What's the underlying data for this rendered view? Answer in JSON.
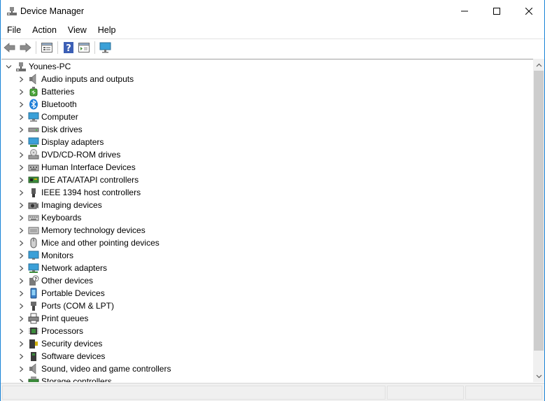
{
  "window": {
    "title": "Device Manager",
    "accent": "#1883d7"
  },
  "menu": {
    "items": [
      "File",
      "Action",
      "View",
      "Help"
    ]
  },
  "toolbar": {
    "buttons": [
      "back-icon",
      "forward-icon",
      "properties-icon",
      "help-icon",
      "show-hide-icon",
      "monitor-icon"
    ]
  },
  "tree": {
    "root": "Younes-PC",
    "categories": [
      {
        "label": "Audio inputs and outputs",
        "icon": "speaker-icon"
      },
      {
        "label": "Batteries",
        "icon": "battery-icon"
      },
      {
        "label": "Bluetooth",
        "icon": "bluetooth-icon"
      },
      {
        "label": "Computer",
        "icon": "computer-icon"
      },
      {
        "label": "Disk drives",
        "icon": "disk-drive-icon"
      },
      {
        "label": "Display adapters",
        "icon": "display-adapter-icon"
      },
      {
        "label": "DVD/CD-ROM drives",
        "icon": "dvd-drive-icon"
      },
      {
        "label": "Human Interface Devices",
        "icon": "hid-icon"
      },
      {
        "label": "IDE ATA/ATAPI controllers",
        "icon": "ide-controller-icon"
      },
      {
        "label": "IEEE 1394 host controllers",
        "icon": "ieee1394-icon"
      },
      {
        "label": "Imaging devices",
        "icon": "camera-icon"
      },
      {
        "label": "Keyboards",
        "icon": "keyboard-icon"
      },
      {
        "label": "Memory technology devices",
        "icon": "memory-icon"
      },
      {
        "label": "Mice and other pointing devices",
        "icon": "mouse-icon"
      },
      {
        "label": "Monitors",
        "icon": "monitor-icon"
      },
      {
        "label": "Network adapters",
        "icon": "network-adapter-icon"
      },
      {
        "label": "Other devices",
        "icon": "unknown-device-icon"
      },
      {
        "label": "Portable Devices",
        "icon": "portable-device-icon"
      },
      {
        "label": "Ports (COM & LPT)",
        "icon": "port-icon"
      },
      {
        "label": "Print queues",
        "icon": "printer-icon"
      },
      {
        "label": "Processors",
        "icon": "processor-icon"
      },
      {
        "label": "Security devices",
        "icon": "security-device-icon"
      },
      {
        "label": "Software devices",
        "icon": "software-device-icon"
      },
      {
        "label": "Sound, video and game controllers",
        "icon": "sound-controller-icon"
      },
      {
        "label": "Storage controllers",
        "icon": "storage-controller-icon"
      }
    ]
  }
}
